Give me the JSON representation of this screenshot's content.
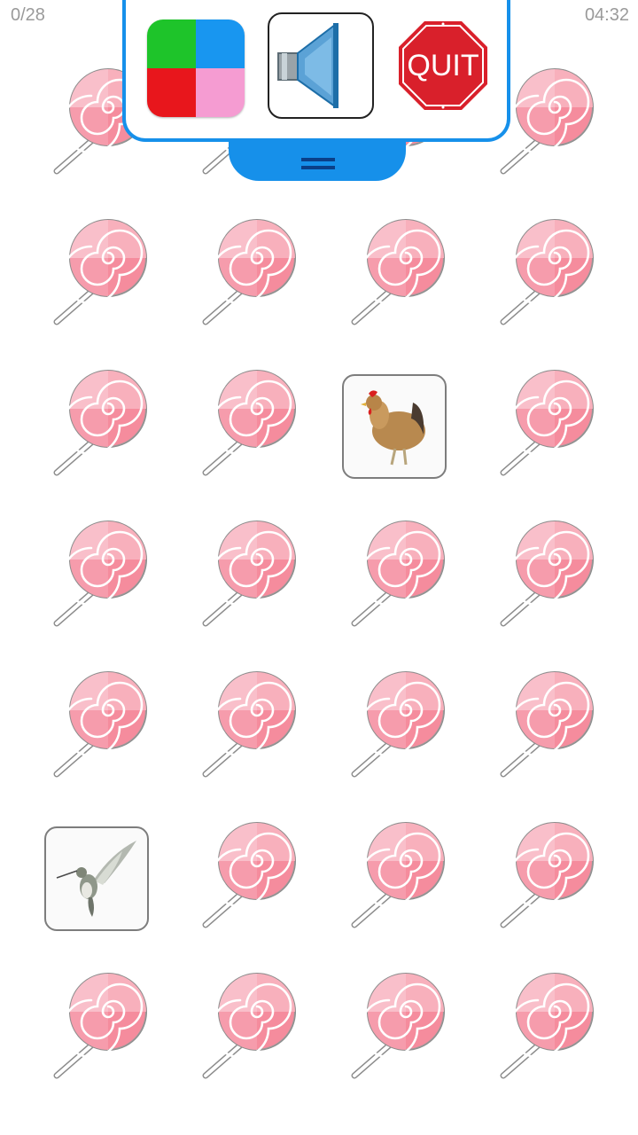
{
  "hud": {
    "score": "0/28",
    "timer": "04:32"
  },
  "menu": {
    "buttons": [
      {
        "name": "color-theme-button",
        "icon": "color-squares-icon"
      },
      {
        "name": "sound-button",
        "icon": "speaker-icon"
      },
      {
        "name": "quit-button",
        "icon": "stop-sign-icon",
        "label": "QUIT"
      }
    ],
    "colors": {
      "accent": "#1690EA",
      "quit": "#D9202B",
      "green": "#1EC42A",
      "blue": "#1896F0",
      "red": "#E8161C",
      "pink": "#F59CD2"
    }
  },
  "board": {
    "rows": 7,
    "cols": 4,
    "revealed": [
      {
        "row": 2,
        "col": 2,
        "image": "chicken-image"
      },
      {
        "row": 5,
        "col": 0,
        "image": "hummingbird-image"
      }
    ],
    "hidden_card_icon": "lollipop-icon"
  }
}
